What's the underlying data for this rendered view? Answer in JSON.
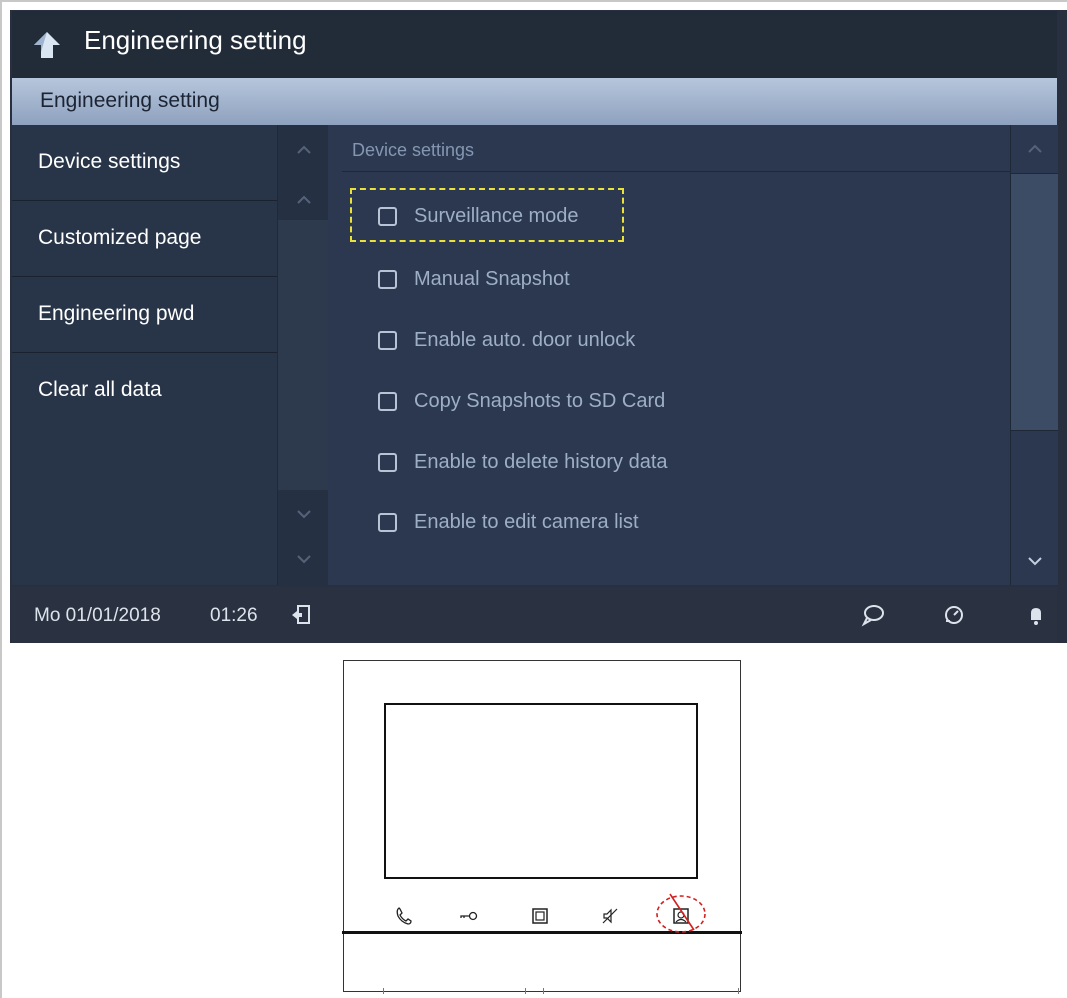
{
  "header": {
    "title": "Engineering setting",
    "back_icon": "back-arrow-icon"
  },
  "subheader": {
    "title": "Engineering setting"
  },
  "sidebar": {
    "items": [
      {
        "label": "Device settings",
        "active": true
      },
      {
        "label": "Customized page",
        "active": false
      },
      {
        "label": "Engineering pwd",
        "active": false
      },
      {
        "label": "Clear all data",
        "active": false
      }
    ]
  },
  "panel": {
    "section_title": "Device settings",
    "options": [
      {
        "label": "Surveillance mode",
        "checked": false,
        "highlighted": true
      },
      {
        "label": "Manual Snapshot",
        "checked": false
      },
      {
        "label": "Enable auto. door unlock",
        "checked": false
      },
      {
        "label": "Copy Snapshots to SD Card",
        "checked": false
      },
      {
        "label": "Enable to delete history data",
        "checked": false
      },
      {
        "label": "Enable to edit camera list",
        "checked": false
      }
    ]
  },
  "statusbar": {
    "date": "Mo 01/01/2018",
    "time": "01:26",
    "icons": [
      "door-exit-icon",
      "message-icon",
      "history-icon",
      "bell-icon"
    ]
  },
  "device": {
    "buttons": [
      "phone-icon",
      "key-icon",
      "square-icon",
      "mute-icon",
      "surveillance-icon"
    ],
    "highlighted_button": "surveillance-icon"
  },
  "colors": {
    "highlight_dashed": "#e8e23a",
    "device_circle": "#d22020",
    "screen_bg": "#283447"
  }
}
